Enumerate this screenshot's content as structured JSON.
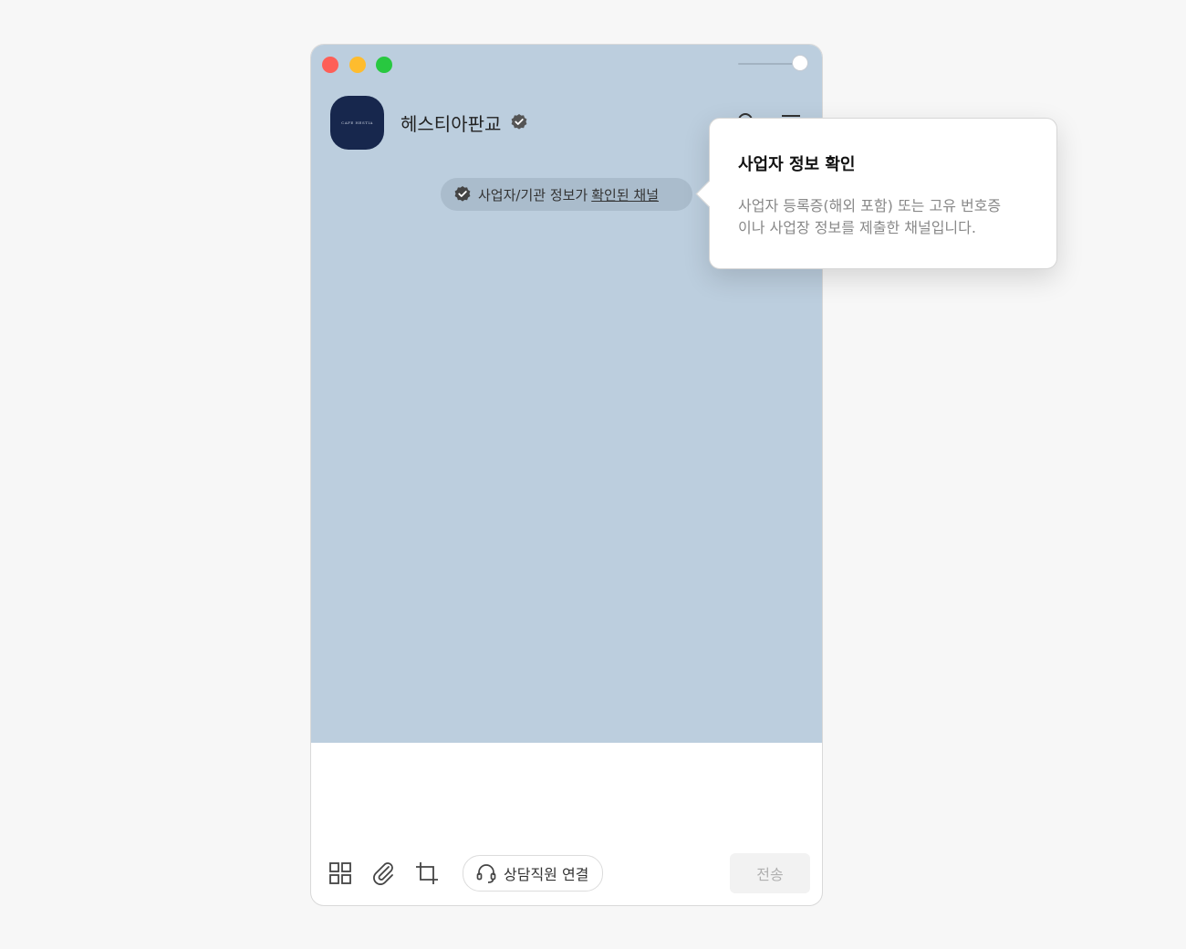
{
  "header": {
    "channel_name": "헤스티아판교",
    "avatar_text": "CAFE HESTIA"
  },
  "verification_pill": {
    "text": "사업자/기관 정보가",
    "link": "확인된 채널"
  },
  "tooltip": {
    "title": "사업자 정보 확인",
    "body_line1": "사업자 등록증(해외 포함) 또는 고유 번호증",
    "body_line2": "이나 사업장 정보를 제출한 채널입니다."
  },
  "toolbar": {
    "agent_label": "상담직원 연결",
    "send_label": "전송"
  },
  "icons": {
    "verified": "verified-badge-icon",
    "search": "search-icon",
    "menu": "menu-icon",
    "emoticon_grid": "grid-icon",
    "attach": "paperclip-icon",
    "capture": "crop-icon",
    "headset": "headset-icon"
  },
  "colors": {
    "chat_background": "#bccede",
    "avatar_background": "#17274d",
    "close": "#fe5f57",
    "minimize": "#febc2e",
    "zoom": "#28c840"
  }
}
